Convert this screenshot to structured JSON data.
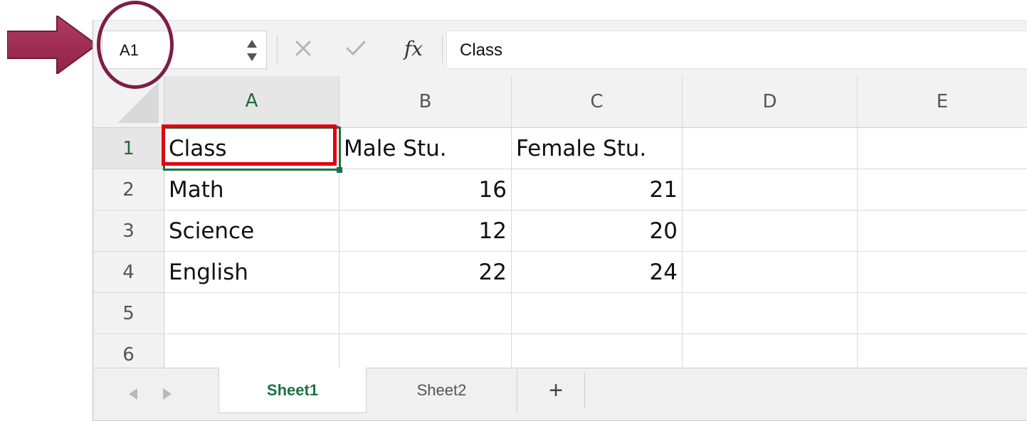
{
  "name_box": {
    "value": "A1"
  },
  "formula_bar": {
    "fx_label": "fx",
    "value": "Class"
  },
  "columns": [
    "A",
    "B",
    "C",
    "D",
    "E"
  ],
  "rows": [
    "1",
    "2",
    "3",
    "4",
    "5",
    "6"
  ],
  "cells": {
    "r1": [
      "Class",
      "Male Stu.",
      "Female Stu."
    ],
    "r2": [
      "Math",
      "16",
      "21"
    ],
    "r3": [
      "Science",
      "12",
      "20"
    ],
    "r4": [
      "English",
      "22",
      "24"
    ]
  },
  "sheet_tabs": [
    {
      "label": "Sheet1",
      "active": true
    },
    {
      "label": "Sheet2",
      "active": false
    }
  ],
  "add_sheet_label": "+",
  "colors": {
    "active_green": "#1e7145",
    "highlight_red": "#e3000f",
    "annotation_maroon": "#7b1f43",
    "arrow_fill": "#a12d54"
  },
  "active_cell": "A1"
}
